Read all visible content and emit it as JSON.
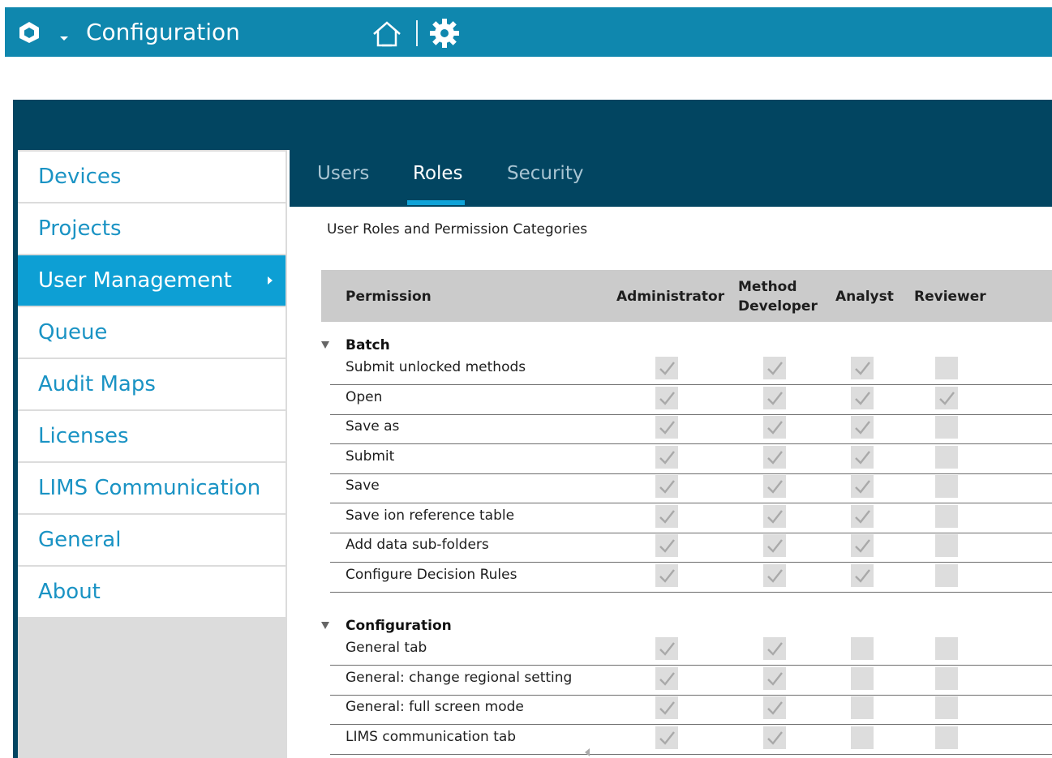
{
  "app": {
    "title": "Configuration",
    "logo_icon": "hexagon-logo-icon",
    "home_icon": "home-icon",
    "settings_icon": "gear-icon",
    "bar_color": "#0f87ae"
  },
  "sidebar": {
    "items": [
      {
        "label": "Devices",
        "active": false
      },
      {
        "label": "Projects",
        "active": false
      },
      {
        "label": "User Management",
        "active": true
      },
      {
        "label": "Queue",
        "active": false
      },
      {
        "label": "Audit Maps",
        "active": false
      },
      {
        "label": "Licenses",
        "active": false
      },
      {
        "label": "LIMS Communication",
        "active": false
      },
      {
        "label": "General",
        "active": false
      },
      {
        "label": "About",
        "active": false
      }
    ]
  },
  "tabs": [
    {
      "label": "Users",
      "active": false
    },
    {
      "label": "Roles",
      "active": true
    },
    {
      "label": "Security",
      "active": false
    }
  ],
  "roles": {
    "section_title": "User Roles and Permission Categories",
    "columns": {
      "permission": "Permission",
      "administrator": "Administrator",
      "method_line1": "Method",
      "method_line2": "Developer",
      "analyst": "Analyst",
      "reviewer": "Reviewer"
    },
    "groups": [
      {
        "name": "Batch",
        "rows": [
          {
            "label": "Submit unlocked methods",
            "checks": [
              true,
              true,
              true,
              false
            ]
          },
          {
            "label": "Open",
            "checks": [
              true,
              true,
              true,
              true
            ]
          },
          {
            "label": "Save as",
            "checks": [
              true,
              true,
              true,
              false
            ]
          },
          {
            "label": "Submit",
            "checks": [
              true,
              true,
              true,
              false
            ]
          },
          {
            "label": "Save",
            "checks": [
              true,
              true,
              true,
              false
            ]
          },
          {
            "label": "Save ion reference table",
            "checks": [
              true,
              true,
              true,
              false
            ]
          },
          {
            "label": "Add data sub-folders",
            "checks": [
              true,
              true,
              true,
              false
            ]
          },
          {
            "label": "Configure Decision Rules",
            "checks": [
              true,
              true,
              true,
              false
            ]
          }
        ]
      },
      {
        "name": "Configuration",
        "rows": [
          {
            "label": "General tab",
            "checks": [
              true,
              true,
              false,
              false
            ]
          },
          {
            "label": "General: change regional setting",
            "checks": [
              true,
              true,
              false,
              false
            ]
          },
          {
            "label": "General: full screen mode",
            "checks": [
              true,
              true,
              false,
              false
            ]
          },
          {
            "label": "LIMS communication tab",
            "checks": [
              true,
              true,
              false,
              false
            ]
          }
        ]
      }
    ]
  }
}
